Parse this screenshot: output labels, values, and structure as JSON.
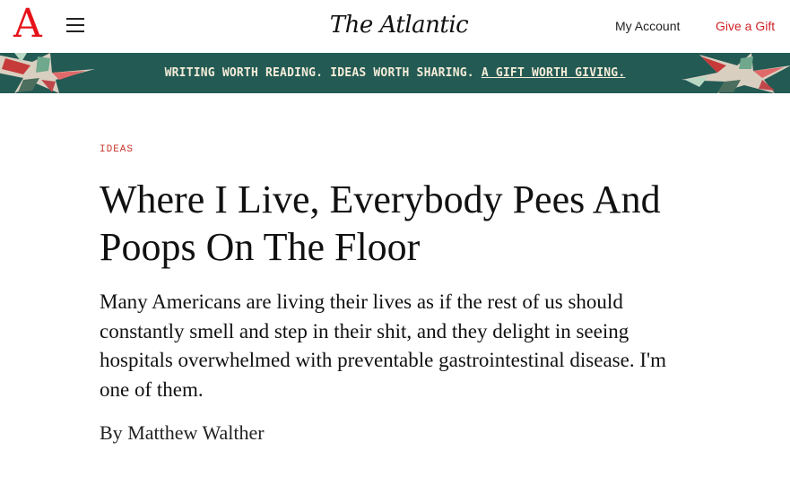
{
  "header": {
    "logo_letter": "A",
    "wordmark": "The Atlantic",
    "my_account": "My Account",
    "give_gift": "Give a Gift",
    "logo_color": "#e7131a",
    "gift_color": "#d0232a"
  },
  "banner": {
    "text": "WRITING WORTH READING. IDEAS WORTH SHARING.",
    "link": "A GIFT WORTH GIVING.",
    "background": "#235a54",
    "text_color": "#f4ecd8"
  },
  "article": {
    "section": "IDEAS",
    "headline": "Where I Live, Everybody Pees And Poops On The Floor",
    "dek": "Many Americans are living their lives as if the rest of us should constantly smell and step in their shit, and they delight in seeing hospitals overwhelmed with preventable gastrointestinal disease. I'm one of them.",
    "byline_prefix": "By",
    "author": "Matthew Walther",
    "section_color": "#c8342b"
  },
  "icons": {
    "menu": "hamburger-menu-icon",
    "banner_decoration": "gift-ribbon-decoration"
  }
}
